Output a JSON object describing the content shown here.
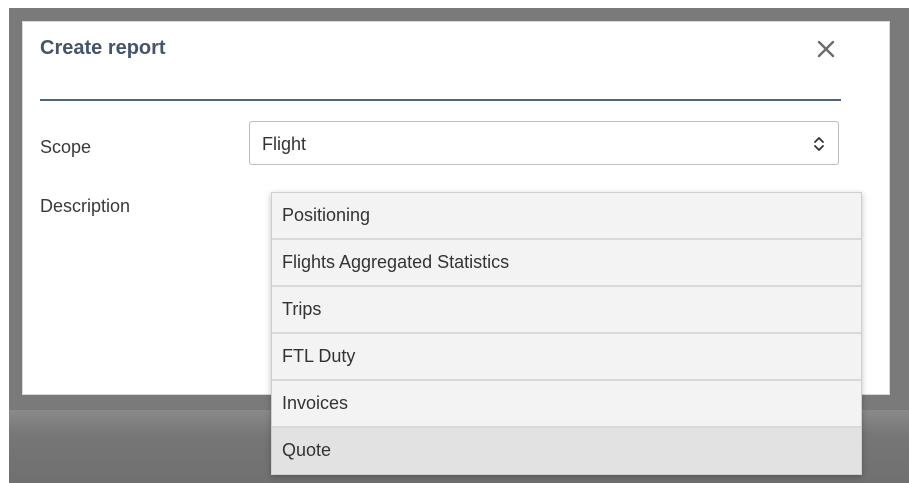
{
  "modal": {
    "title": "Create report",
    "close_icon": "close-icon"
  },
  "form": {
    "scope_label": "Scope",
    "description_label": "Description",
    "scope_select": {
      "selected": "Flight",
      "arrow_icon": "chevron-up-down-icon"
    }
  },
  "dropdown": {
    "options": [
      {
        "label": "Positioning"
      },
      {
        "label": "Flights Aggregated Statistics"
      },
      {
        "label": "Trips"
      },
      {
        "label": "FTL Duty"
      },
      {
        "label": "Invoices"
      },
      {
        "label": "Quote",
        "highlighted": true
      }
    ]
  },
  "colors": {
    "title": "#44546a",
    "rule": "#4f6478",
    "backdrop": "#7a7a7a",
    "option_bg": "#f3f3f3",
    "option_highlight": "#e2e2e2"
  }
}
